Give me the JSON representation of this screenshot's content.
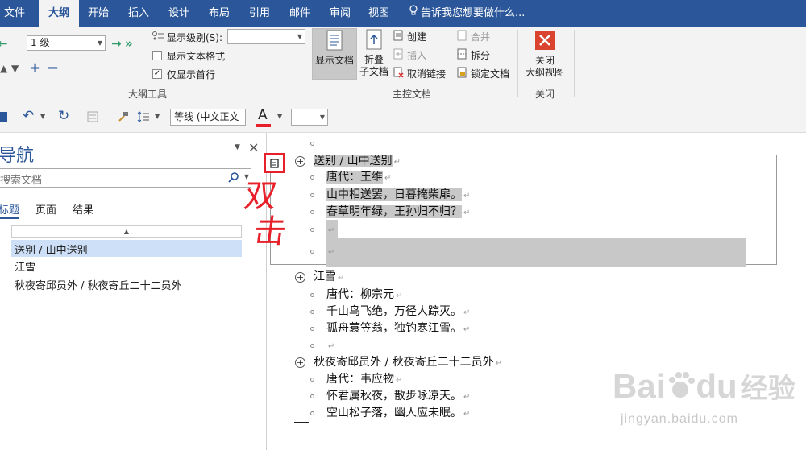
{
  "tabs": [
    {
      "label": "文件"
    },
    {
      "label": "大纲"
    },
    {
      "label": "开始"
    },
    {
      "label": "插入"
    },
    {
      "label": "设计"
    },
    {
      "label": "布局"
    },
    {
      "label": "引用"
    },
    {
      "label": "邮件"
    },
    {
      "label": "审阅"
    },
    {
      "label": "视图"
    }
  ],
  "tell_me": "告诉我您想要做什么...",
  "ribbon": {
    "level_value": "1 级",
    "show_level_label": "显示级别(S):",
    "show_text_format": "显示文本格式",
    "show_first_line": "仅显示首行",
    "outline_tools_label": "大纲工具",
    "show_document": "显示文档",
    "collapse_sub_1": "折叠",
    "collapse_sub_2": "子文档",
    "create": "创建",
    "insert": "插入",
    "unlink": "取消链接",
    "merge": "合并",
    "split": "拆分",
    "lock_document": "锁定文档",
    "master_doc_label": "主控文档",
    "close_outline_1": "关闭",
    "close_outline_2": "大纲视图",
    "close_label": "关闭"
  },
  "qat": {
    "font_name": "等线 (中文正文"
  },
  "nav": {
    "title": "导航",
    "search_placeholder": "搜索文档",
    "tabs": [
      "标题",
      "页面",
      "结果"
    ],
    "items": [
      "送别 / 山中送别",
      "江雪",
      "秋夜寄邱员外 / 秋夜寄丘二十二员外"
    ]
  },
  "annotation": {
    "line1": "双",
    "line2": "击"
  },
  "doc": {
    "lines": [
      {
        "text": "送别 / 山中送别",
        "level": 1
      },
      {
        "text": "唐代：王维",
        "level": 2
      },
      {
        "text": "山中相送罢，日暮掩柴扉。",
        "level": 2
      },
      {
        "text": "春草明年绿，王孙归不归？",
        "level": 2
      },
      {
        "text": "",
        "level": 2
      },
      {
        "text": "",
        "level": 2
      },
      {
        "text": "江雪",
        "level": 1
      },
      {
        "text": "唐代：柳宗元",
        "level": 2
      },
      {
        "text": "千山鸟飞绝，万径人踪灭。",
        "level": 2
      },
      {
        "text": "孤舟蓑笠翁，独钓寒江雪。",
        "level": 2
      },
      {
        "text": "",
        "level": 2
      },
      {
        "text": "秋夜寄邱员外 / 秋夜寄丘二十二员外",
        "level": 1
      },
      {
        "text": "唐代：韦应物",
        "level": 2
      },
      {
        "text": "怀君属秋夜，散步咏凉天。",
        "level": 2
      },
      {
        "text": "空山松子落，幽人应未眠。",
        "level": 2
      }
    ]
  },
  "watermark": {
    "brand": "Bai",
    "brand2": "du",
    "brand_cn": "经验",
    "url": "jingyan.baidu.com"
  },
  "colors": {
    "accent": "#2b579a",
    "annotation": "#e8202a",
    "highlight": "#c8c8c8",
    "nav_selected": "#cde0f7"
  }
}
